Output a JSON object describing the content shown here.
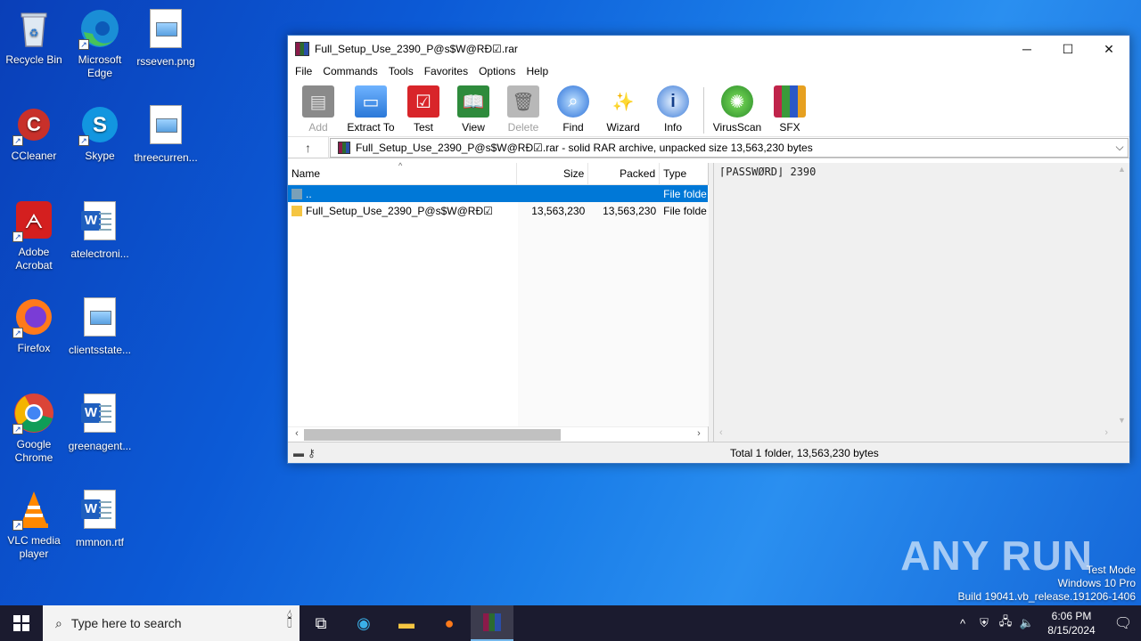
{
  "desktop": {
    "icons": [
      {
        "label": "Recycle Bin"
      },
      {
        "label": "Microsoft Edge"
      },
      {
        "label": "rsseven.png"
      },
      {
        "label": "CCleaner"
      },
      {
        "label": "Skype"
      },
      {
        "label": "threecurren..."
      },
      {
        "label": "Adobe Acrobat"
      },
      {
        "label": "atelectroni..."
      },
      {
        "label": "Firefox"
      },
      {
        "label": "clientsstate..."
      },
      {
        "label": "Google Chrome"
      },
      {
        "label": "greenagent..."
      },
      {
        "label": "VLC media player"
      },
      {
        "label": "mmnon.rtf"
      }
    ]
  },
  "window": {
    "title": "Full_Setup_Use_2390_P@s$W@RÐ☑.rar",
    "controls": {
      "minimize": "─",
      "maximize": "☐",
      "close": "✕"
    },
    "menu": [
      "File",
      "Commands",
      "Tools",
      "Favorites",
      "Options",
      "Help"
    ],
    "toolbar": [
      {
        "label": "Add",
        "icon": "add-icon",
        "disabled": true
      },
      {
        "label": "Extract To",
        "icon": "extract-to-icon",
        "disabled": false
      },
      {
        "label": "Test",
        "icon": "test-icon",
        "disabled": false
      },
      {
        "label": "View",
        "icon": "view-icon",
        "disabled": false
      },
      {
        "label": "Delete",
        "icon": "delete-icon",
        "disabled": true
      },
      {
        "label": "Find",
        "icon": "find-icon",
        "disabled": false
      },
      {
        "label": "Wizard",
        "icon": "wizard-icon",
        "disabled": false
      },
      {
        "label": "Info",
        "icon": "info-icon",
        "disabled": false
      },
      {
        "label": "VirusScan",
        "icon": "virusscan-icon",
        "disabled": false
      },
      {
        "label": "SFX",
        "icon": "sfx-icon",
        "disabled": false
      }
    ],
    "address": "Full_Setup_Use_2390_P@s$W@RÐ☑.rar - solid RAR archive, unpacked size 13,563,230 bytes",
    "columns": {
      "name": "Name",
      "size": "Size",
      "packed": "Packed",
      "type": "Type"
    },
    "rows": [
      {
        "name": "..",
        "size": "",
        "packed": "",
        "type": "File folde",
        "selected": true
      },
      {
        "name": "Full_Setup_Use_2390_P@s$W@RÐ☑",
        "size": "13,563,230",
        "packed": "13,563,230",
        "type": "File folde",
        "selected": false
      }
    ],
    "comment": "⌈PASSWØRD⌋ 2390",
    "status": "Total 1 folder, 13,563,230 bytes"
  },
  "watermark": {
    "logo": "ANY RUN",
    "line1": "Test Mode",
    "line2": "Windows 10 Pro",
    "line3": "Build 19041.vb_release.191206-1406"
  },
  "taskbar": {
    "search_placeholder": "Type here to search",
    "time": "6:06 PM",
    "date": "8/15/2024"
  },
  "colors": {
    "accent": "#0078d7",
    "taskbar": "#1b1b2f"
  }
}
